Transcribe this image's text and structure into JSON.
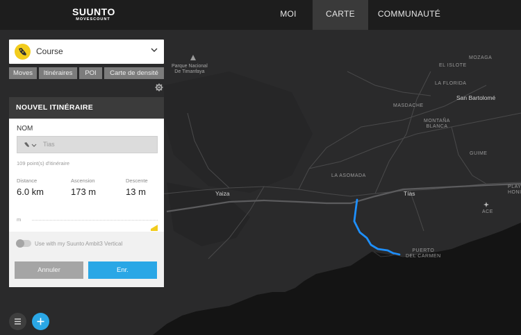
{
  "header": {
    "brand": "SUUNTO",
    "brand_sub": "MOVESCOUNT",
    "nav": [
      {
        "label": "MOI",
        "active": false
      },
      {
        "label": "CARTE",
        "active": true
      },
      {
        "label": "COMMUNAUTÉ",
        "active": false
      }
    ]
  },
  "sport_select": {
    "value": "Course",
    "icon": "running-shoe-icon"
  },
  "filters": [
    "Moves",
    "Itinéraires",
    "POI",
    "Carte de densité"
  ],
  "panel": {
    "title": "NOUVEL ITINÉRAIRE",
    "name_label": "NOM",
    "name_placeholder": "Tias",
    "points_text": "109  point(s) d'itinéraire",
    "stats": [
      {
        "label": "Distance",
        "value": "6.0 km"
      },
      {
        "label": "Ascension",
        "value": "173 m"
      },
      {
        "label": "Descente",
        "value": "13 m"
      }
    ],
    "graph_unit": "m",
    "toggle_label": "Use with my Suunto Ambit3 Vertical",
    "toggle_on": false,
    "cancel_label": "Annuler",
    "save_label": "Enr."
  },
  "map": {
    "park": "Parque Nacional\nDe Timanfaya",
    "places": [
      {
        "name": "MOZAGA"
      },
      {
        "name": "EL ISLOTE"
      },
      {
        "name": "LA FLORIDA"
      },
      {
        "name": "MASDACHE"
      },
      {
        "name": "MONTAÑA\nBLANCA"
      },
      {
        "name": "GUIME"
      },
      {
        "name": "LA ASOMADA"
      },
      {
        "name": "PLAY\nHONI"
      },
      {
        "name": "ACE"
      },
      {
        "name": "PUERTO\nDEL CARMEN"
      }
    ],
    "towns": [
      {
        "name": "San Bartolomé"
      },
      {
        "name": "Yaiza"
      },
      {
        "name": "Tías"
      }
    ],
    "route_color": "#1e90ff"
  },
  "colors": {
    "accent": "#2aa7e6",
    "sport_icon": "#f2cc1d"
  }
}
